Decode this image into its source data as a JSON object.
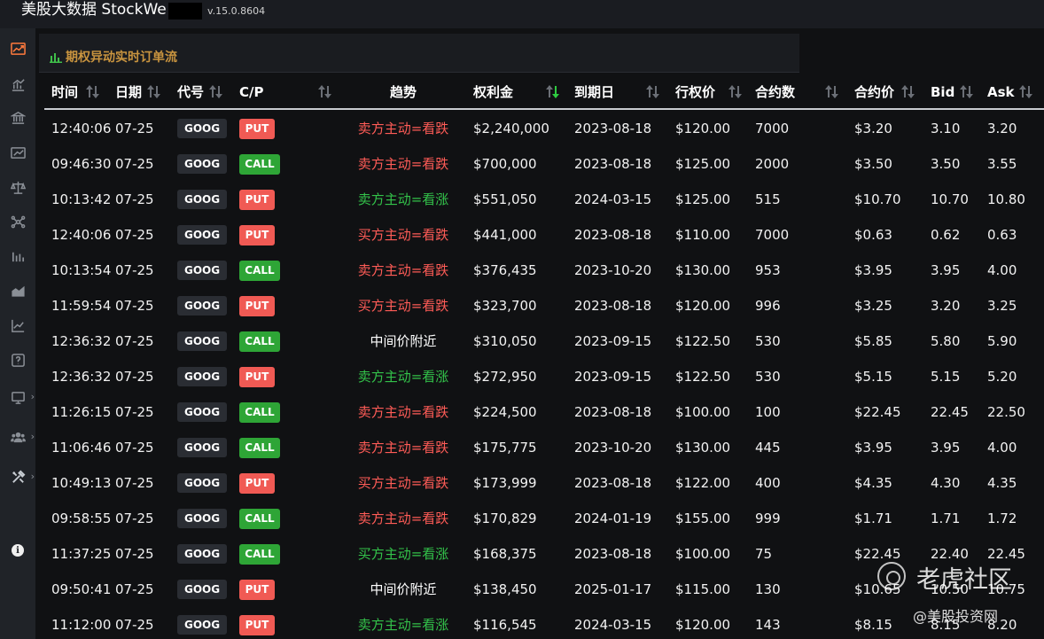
{
  "app": {
    "title": "美股大数据 StockWe",
    "version": "v.15.0.8604"
  },
  "panel": {
    "title": "期权异动实时订单流"
  },
  "table": {
    "headers": [
      "时间",
      "日期",
      "代号",
      "C/P",
      "趋势",
      "权利金",
      "到期日",
      "行权价",
      "合约数",
      "合约价",
      "Bid",
      "Ask"
    ],
    "active_sort_column": "权利金",
    "rows": [
      {
        "time": "12:40:06",
        "date": "07-25",
        "ticker": "GOOG",
        "cp": "PUT",
        "trend": "卖方主动=看跌",
        "trend_color": "red",
        "premium": "$2,240,000",
        "expiry": "2023-08-18",
        "strike": "$120.00",
        "contracts": "7000",
        "price": "$3.20",
        "bid": "3.10",
        "ask": "3.20"
      },
      {
        "time": "09:46:30",
        "date": "07-25",
        "ticker": "GOOG",
        "cp": "CALL",
        "trend": "卖方主动=看跌",
        "trend_color": "red",
        "premium": "$700,000",
        "expiry": "2023-08-18",
        "strike": "$125.00",
        "contracts": "2000",
        "price": "$3.50",
        "bid": "3.50",
        "ask": "3.55"
      },
      {
        "time": "10:13:42",
        "date": "07-25",
        "ticker": "GOOG",
        "cp": "PUT",
        "trend": "卖方主动=看涨",
        "trend_color": "green",
        "premium": "$551,050",
        "expiry": "2024-03-15",
        "strike": "$125.00",
        "contracts": "515",
        "price": "$10.70",
        "bid": "10.70",
        "ask": "10.80"
      },
      {
        "time": "12:40:06",
        "date": "07-25",
        "ticker": "GOOG",
        "cp": "PUT",
        "trend": "买方主动=看跌",
        "trend_color": "red",
        "premium": "$441,000",
        "expiry": "2023-08-18",
        "strike": "$110.00",
        "contracts": "7000",
        "price": "$0.63",
        "bid": "0.62",
        "ask": "0.63"
      },
      {
        "time": "10:13:54",
        "date": "07-25",
        "ticker": "GOOG",
        "cp": "CALL",
        "trend": "卖方主动=看跌",
        "trend_color": "red",
        "premium": "$376,435",
        "expiry": "2023-10-20",
        "strike": "$130.00",
        "contracts": "953",
        "price": "$3.95",
        "bid": "3.95",
        "ask": "4.00"
      },
      {
        "time": "11:59:54",
        "date": "07-25",
        "ticker": "GOOG",
        "cp": "PUT",
        "trend": "买方主动=看跌",
        "trend_color": "red",
        "premium": "$323,700",
        "expiry": "2023-08-18",
        "strike": "$120.00",
        "contracts": "996",
        "price": "$3.25",
        "bid": "3.20",
        "ask": "3.25"
      },
      {
        "time": "12:36:32",
        "date": "07-25",
        "ticker": "GOOG",
        "cp": "CALL",
        "trend": "中间价附近",
        "trend_color": "white",
        "premium": "$310,050",
        "expiry": "2023-09-15",
        "strike": "$122.50",
        "contracts": "530",
        "price": "$5.85",
        "bid": "5.80",
        "ask": "5.90"
      },
      {
        "time": "12:36:32",
        "date": "07-25",
        "ticker": "GOOG",
        "cp": "PUT",
        "trend": "卖方主动=看涨",
        "trend_color": "green",
        "premium": "$272,950",
        "expiry": "2023-09-15",
        "strike": "$122.50",
        "contracts": "530",
        "price": "$5.15",
        "bid": "5.15",
        "ask": "5.20"
      },
      {
        "time": "11:26:15",
        "date": "07-25",
        "ticker": "GOOG",
        "cp": "CALL",
        "trend": "卖方主动=看跌",
        "trend_color": "red",
        "premium": "$224,500",
        "expiry": "2023-08-18",
        "strike": "$100.00",
        "contracts": "100",
        "price": "$22.45",
        "bid": "22.45",
        "ask": "22.50"
      },
      {
        "time": "11:06:46",
        "date": "07-25",
        "ticker": "GOOG",
        "cp": "CALL",
        "trend": "卖方主动=看跌",
        "trend_color": "red",
        "premium": "$175,775",
        "expiry": "2023-10-20",
        "strike": "$130.00",
        "contracts": "445",
        "price": "$3.95",
        "bid": "3.95",
        "ask": "4.00"
      },
      {
        "time": "10:49:13",
        "date": "07-25",
        "ticker": "GOOG",
        "cp": "PUT",
        "trend": "买方主动=看跌",
        "trend_color": "red",
        "premium": "$173,999",
        "expiry": "2023-08-18",
        "strike": "$122.00",
        "contracts": "400",
        "price": "$4.35",
        "bid": "4.30",
        "ask": "4.35"
      },
      {
        "time": "09:58:55",
        "date": "07-25",
        "ticker": "GOOG",
        "cp": "CALL",
        "trend": "卖方主动=看跌",
        "trend_color": "red",
        "premium": "$170,829",
        "expiry": "2024-01-19",
        "strike": "$155.00",
        "contracts": "999",
        "price": "$1.71",
        "bid": "1.71",
        "ask": "1.72"
      },
      {
        "time": "11:37:25",
        "date": "07-25",
        "ticker": "GOOG",
        "cp": "CALL",
        "trend": "买方主动=看涨",
        "trend_color": "green",
        "premium": "$168,375",
        "expiry": "2023-08-18",
        "strike": "$100.00",
        "contracts": "75",
        "price": "$22.45",
        "bid": "22.40",
        "ask": "22.45"
      },
      {
        "time": "09:50:41",
        "date": "07-25",
        "ticker": "GOOG",
        "cp": "PUT",
        "trend": "中间价附近",
        "trend_color": "white",
        "premium": "$138,450",
        "expiry": "2025-01-17",
        "strike": "$115.00",
        "contracts": "130",
        "price": "$10.65",
        "bid": "10.50",
        "ask": "10.75"
      },
      {
        "time": "11:12:00",
        "date": "07-25",
        "ticker": "GOOG",
        "cp": "PUT",
        "trend": "卖方主动=看涨",
        "trend_color": "green",
        "premium": "$116,545",
        "expiry": "2024-03-15",
        "strike": "$120.00",
        "contracts": "143",
        "price": "$8.15",
        "bid": "8.15",
        "ask": "8.20"
      }
    ]
  },
  "watermark": {
    "line1": "老虎社区",
    "line2": "@美股投资网"
  },
  "colors": {
    "put": "#f05a54",
    "call": "#2ea536",
    "trend_red": "#ff5c57",
    "trend_green": "#33c24a",
    "accent": "#c9943f"
  },
  "sidebar_icons": [
    "trend-icon",
    "bar-chart-icon",
    "bank-icon",
    "chart-up-icon",
    "scale-icon",
    "network-icon",
    "column-chart-icon",
    "area-chart-icon",
    "line-chart-icon",
    "question-icon",
    "monitor-icon",
    "users-icon",
    "tools-icon",
    "info-icon"
  ]
}
